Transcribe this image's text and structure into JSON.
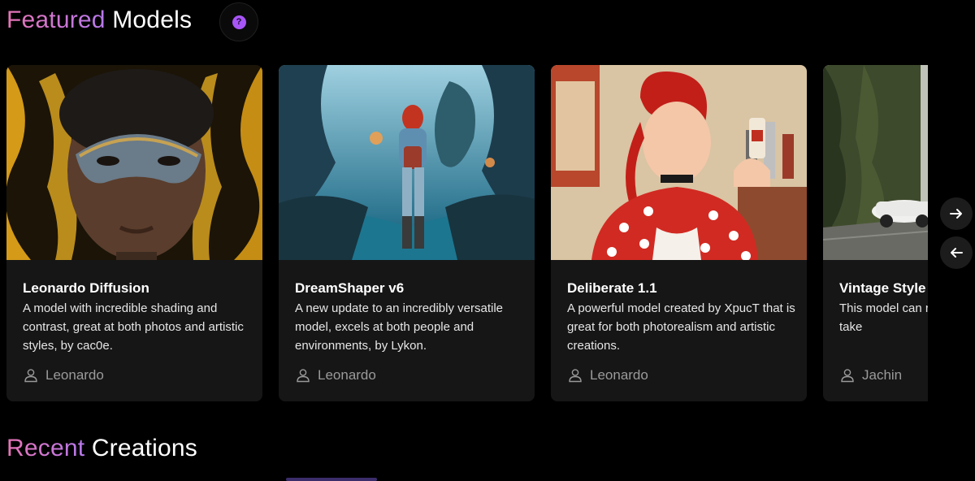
{
  "featured": {
    "title_accent": "Featured",
    "title_plain": "Models",
    "help_icon": "question-circle-icon",
    "help_symbol": "?"
  },
  "recent": {
    "title_accent": "Recent",
    "title_plain": "Creations"
  },
  "cards": [
    {
      "title": "Leonardo Diffusion",
      "description": "A model with incredible shading and contrast, great at both photos and artistic styles, by cac0e.",
      "author": "Leonardo"
    },
    {
      "title": "DreamShaper v6",
      "description": "A new update to an incredibly versatile model, excels at both people and environments, by Lykon.",
      "author": "Leonardo"
    },
    {
      "title": "Deliberate 1.1",
      "description": "A powerful model created by XpucT that is great for both photorealism and artistic creations.",
      "author": "Leonardo"
    },
    {
      "title": "Vintage Style",
      "description": "This model can range of image as if it was take",
      "author": "Jachin"
    }
  ],
  "colors": {
    "accent_start": "#e774b6",
    "accent_end": "#b678ec",
    "card_bg": "#161616",
    "page_bg": "#000000"
  },
  "nav": {
    "next_icon": "arrow-right-icon",
    "prev_icon": "arrow-left-icon"
  }
}
